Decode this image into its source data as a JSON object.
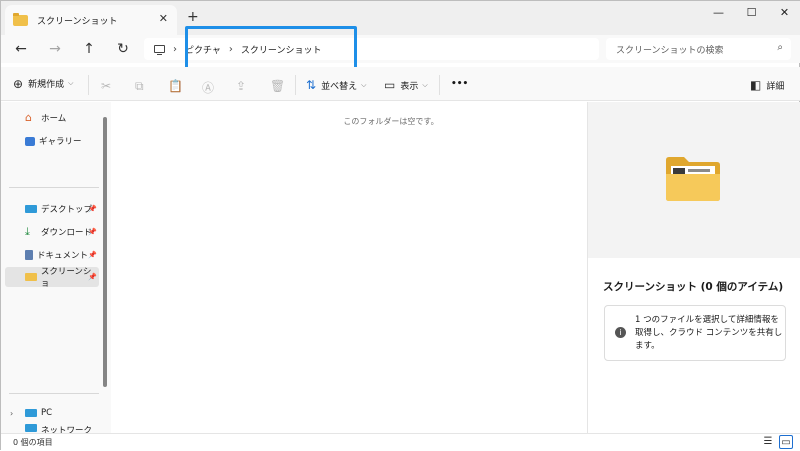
{
  "window": {
    "tab_title": "スクリーンショット",
    "tab_close": "✕",
    "new_tab": "+",
    "minimize": "—",
    "maximize": "☐",
    "close": "✕"
  },
  "nav": {
    "back": "←",
    "forward": "→",
    "up": "↑",
    "refresh": "↻"
  },
  "address": {
    "crumbs": [
      "ピクチャ",
      "スクリーンショット"
    ],
    "separator": "›",
    "highlight_color": "#1e8fe8"
  },
  "search": {
    "placeholder": "スクリーンショットの検索",
    "icon": "search-icon"
  },
  "toolbar": {
    "new_label": "新規作成",
    "sort_label": "並べ替え",
    "view_label": "表示",
    "more_label": "•••",
    "details_label": "詳細"
  },
  "sidebar": {
    "home": "ホーム",
    "gallery": "ギャラリー",
    "items": [
      {
        "label": "デスクトップ",
        "icon": "desktop-icon"
      },
      {
        "label": "ダウンロード",
        "icon": "download-icon"
      },
      {
        "label": "ドキュメント",
        "icon": "document-icon"
      },
      {
        "label": "スクリーンショ",
        "icon": "folder-icon"
      }
    ],
    "pc": "PC",
    "network": "ネットワーク"
  },
  "content": {
    "empty_message": "このフォルダーは空です。"
  },
  "details": {
    "title": "スクリーンショット (0 個のアイテム)",
    "info": "1 つのファイルを選択して詳細情報を取得し、クラウド コンテンツを共有します。"
  },
  "status": {
    "item_count": "0 個の項目"
  },
  "colors": {
    "accent": "#1e8fe8",
    "folder": "#f0c04a"
  }
}
